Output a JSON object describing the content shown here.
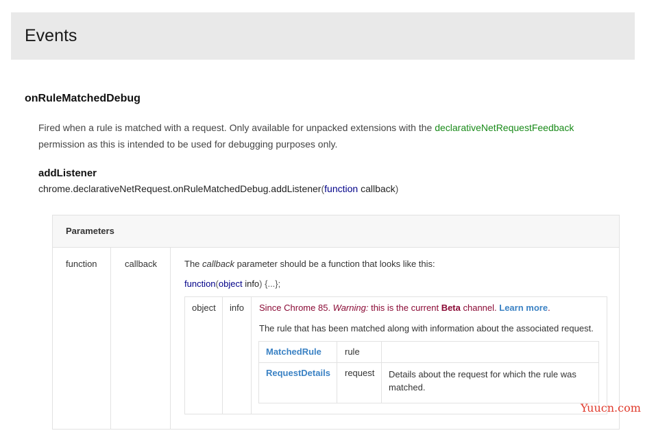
{
  "header": {
    "title": "Events"
  },
  "event": {
    "name": "onRuleMatchedDebug",
    "desc_part1": "Fired when a rule is matched with a request. Only available for unpacked extensions with the ",
    "desc_link": "declarativeNetRequestFeedback",
    "desc_part2": "permission as this is intended to be used for debugging purposes only."
  },
  "listener": {
    "title": "addListener",
    "prefix": "chrome.declarativeNetRequest.onRuleMatchedDebug.addListener",
    "open_paren": "(",
    "kw_function": "function",
    "param": " callback",
    "close_paren": ")"
  },
  "parameters": {
    "header": "Parameters",
    "row": {
      "type": "function",
      "name": "callback",
      "intro_prefix": "The ",
      "intro_em": "callback",
      "intro_suffix": " parameter should be a function that looks like this:",
      "sig_function": "function",
      "sig_open": "(",
      "sig_object": "object",
      "sig_param": " info",
      "sig_rest": ") {...};"
    },
    "inner": {
      "type": "object",
      "name": "info",
      "since": "Since Chrome 85. ",
      "warning_label": "Warning:",
      "warning_text": " this is the current ",
      "beta": "Beta",
      "channel_text": " channel. ",
      "learn_more": "Learn more",
      "learn_dot": ".",
      "description": "The rule that has been matched along with information about the associated request.",
      "rows": [
        {
          "type": "MatchedRule",
          "name": "rule",
          "desc": ""
        },
        {
          "type": "RequestDetails",
          "name": "request",
          "desc": "Details about the request for which the rule was matched."
        }
      ]
    }
  },
  "watermark": "Yuucn.com"
}
